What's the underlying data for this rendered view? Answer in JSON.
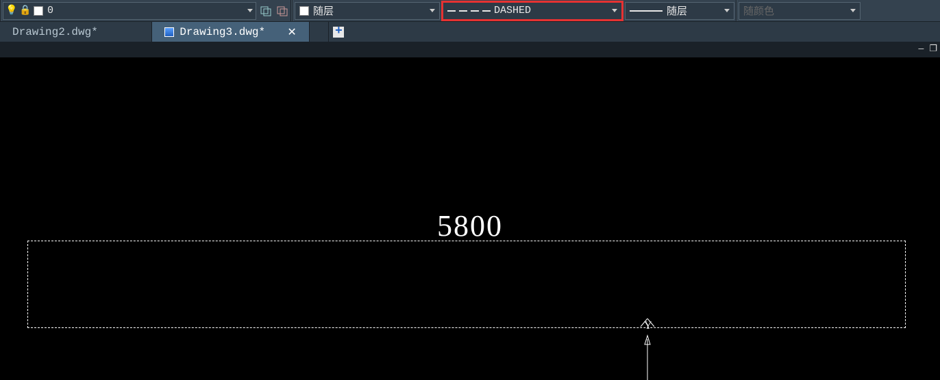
{
  "toolbar": {
    "layer_current": "0",
    "layer_swatch_label": "随层",
    "linetype_label": "DASHED",
    "lineweight_label": "随层",
    "plotstyle_label": "随颜色"
  },
  "tabs": {
    "inactive": "Drawing2.dwg*",
    "active": "Drawing3.dwg*"
  },
  "drawing": {
    "dimension_value": "5800",
    "axis_label": "Y"
  }
}
